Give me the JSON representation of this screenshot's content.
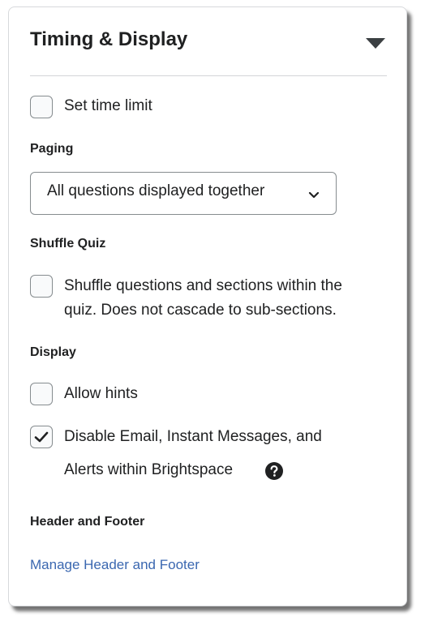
{
  "panel": {
    "title": "Timing & Display"
  },
  "timing": {
    "set_time_limit_label": "Set time limit",
    "set_time_limit_checked": false
  },
  "paging": {
    "label": "Paging",
    "selected": "All questions displayed together"
  },
  "shuffle": {
    "label": "Shuffle Quiz",
    "option_line1": "Shuffle questions and sections within the",
    "option_line2": "quiz. Does not cascade to sub-sections.",
    "checked": false
  },
  "display": {
    "label": "Display",
    "allow_hints_label": "Allow hints",
    "allow_hints_checked": false,
    "disable_email_line1": "Disable Email, Instant Messages, and",
    "disable_email_line2": "Alerts within Brightspace",
    "disable_email_checked": true
  },
  "header_footer": {
    "label": "Header and Footer",
    "manage_link": "Manage Header and Footer"
  },
  "colors": {
    "link": "#3a67b0",
    "text": "#202122",
    "border": "#868c8f"
  }
}
